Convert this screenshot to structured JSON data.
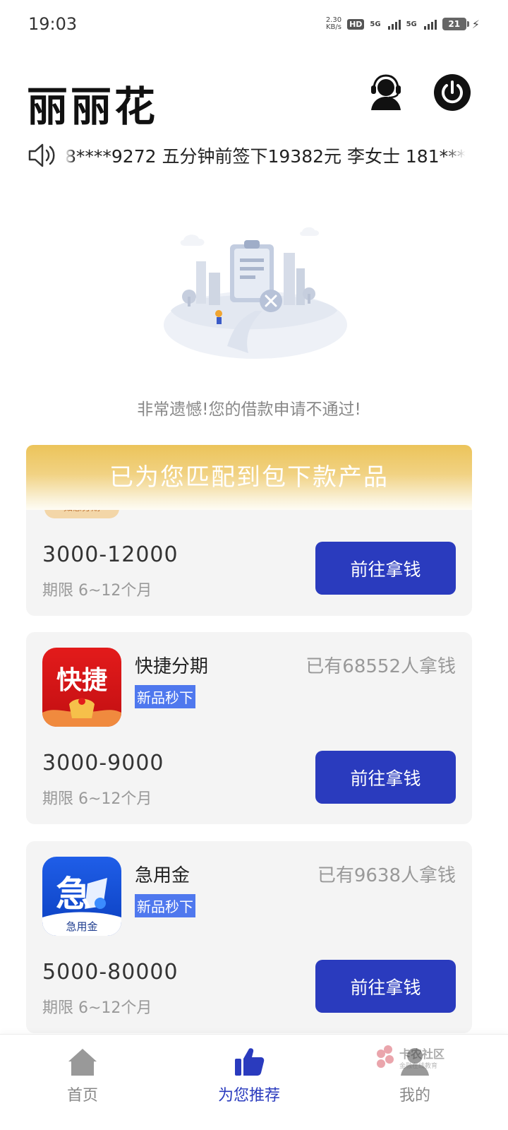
{
  "status_bar": {
    "time": "19:03",
    "net_speed_value": "2.30",
    "net_speed_unit": "KB/s",
    "hd_label": "HD",
    "sim1_label": "5G",
    "sim2_label": "5G",
    "battery": "21"
  },
  "header": {
    "title": "丽丽花"
  },
  "notice": {
    "text": "8****9272 五分钟前签下19382元 李女士 181***"
  },
  "result": {
    "message": "非常遗憾!您的借款申请不通过!"
  },
  "banner": {
    "text": "已为您匹配到包下款产品"
  },
  "products": [
    {
      "tag": "如意分期",
      "amount": "3000-12000",
      "term": "期限 6~12个月",
      "button": "前往拿钱"
    },
    {
      "logo_text": "快捷",
      "name": "快捷分期",
      "badge": "新品秒下",
      "count": "已有68552人拿钱",
      "amount": "3000-9000",
      "term": "期限 6~12个月",
      "button": "前往拿钱"
    },
    {
      "logo_text": "急",
      "logo_subtext": "急用金",
      "name": "急用金",
      "badge": "新品秒下",
      "count": "已有9638人拿钱",
      "amount": "5000-80000",
      "term": "期限 6~12个月",
      "button": "前往拿钱"
    }
  ],
  "bottom_nav": {
    "items": [
      {
        "label": "首页",
        "icon": "home-icon"
      },
      {
        "label": "为您推荐",
        "icon": "thumbs-up-icon",
        "active": true
      },
      {
        "label": "我的",
        "icon": "user-icon"
      }
    ]
  },
  "watermark": {
    "text": "卡农社区",
    "subtext": "金融在线教育"
  },
  "colors": {
    "accent": "#2a3bbe",
    "badge": "#4f78ee",
    "banner_gold": "#ecc45a",
    "card_bg": "#f4f4f4"
  }
}
